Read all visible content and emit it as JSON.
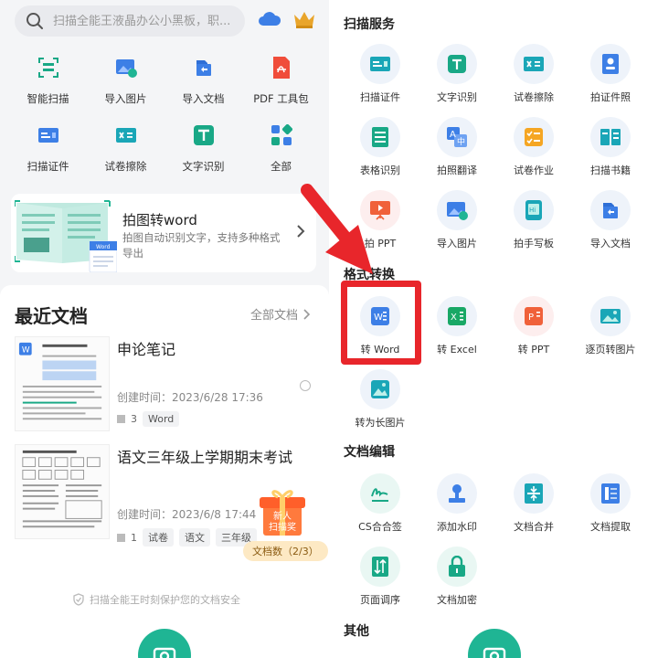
{
  "left": {
    "search": {
      "placeholder": "扫描全能王液晶办公小黑板，职..."
    },
    "top_icons": [
      "cloud-icon",
      "crown-icon"
    ],
    "tools": [
      {
        "label": "智能扫描",
        "icon": "scan-icon"
      },
      {
        "label": "导入图片",
        "icon": "import-image-icon"
      },
      {
        "label": "导入文档",
        "icon": "import-doc-icon"
      },
      {
        "label": "PDF 工具包",
        "icon": "pdf-icon"
      },
      {
        "label": "扫描证件",
        "icon": "id-card-icon"
      },
      {
        "label": "试卷擦除",
        "icon": "erase-icon"
      },
      {
        "label": "文字识别",
        "icon": "text-ocr-icon"
      },
      {
        "label": "全部",
        "icon": "all-apps-icon"
      }
    ],
    "promo": {
      "title": "拍图转word",
      "desc": "拍图自动识别文字，支持多种格式导出",
      "thumb_badge": "Word"
    },
    "recent": {
      "title": "最近文档",
      "all_label": "全部文档",
      "docs": [
        {
          "name": "申论笔记",
          "time": "创建时间：2023/6/28 17:36",
          "count": "3",
          "tags": [
            "Word"
          ]
        },
        {
          "name": "语文三年级上学期期末考试",
          "time": "创建时间：2023/6/8 17:44",
          "count": "1",
          "tags": [
            "试卷",
            "语文",
            "三年级"
          ]
        }
      ],
      "gift_line1": "新人",
      "gift_line2": "扫描奖",
      "doc_count": "文档数（2/3）",
      "security": "扫描全能王时刻保护您的文档安全"
    }
  },
  "right": {
    "sections": [
      {
        "title": "扫描服务",
        "items": [
          {
            "label": "扫描证件",
            "icon": "id-card-icon"
          },
          {
            "label": "文字识别",
            "icon": "text-ocr-icon"
          },
          {
            "label": "试卷擦除",
            "icon": "erase-icon"
          },
          {
            "label": "拍证件照",
            "icon": "id-photo-icon"
          },
          {
            "label": "表格识别",
            "icon": "table-icon"
          },
          {
            "label": "拍照翻译",
            "icon": "translate-icon"
          },
          {
            "label": "试卷作业",
            "icon": "homework-icon"
          },
          {
            "label": "扫描书籍",
            "icon": "book-icon"
          },
          {
            "label": "拍 PPT",
            "icon": "ppt-icon"
          },
          {
            "label": "导入图片",
            "icon": "import-image-icon"
          },
          {
            "label": "拍手写板",
            "icon": "handwriting-icon"
          },
          {
            "label": "导入文档",
            "icon": "import-doc-icon"
          }
        ]
      },
      {
        "title": "格式转换",
        "items": [
          {
            "label": "转 Word",
            "icon": "word-icon"
          },
          {
            "label": "转 Excel",
            "icon": "excel-icon"
          },
          {
            "label": "转 PPT",
            "icon": "ppt-convert-icon"
          },
          {
            "label": "逐页转图片",
            "icon": "image-pages-icon"
          },
          {
            "label": "转为长图片",
            "icon": "long-image-icon"
          }
        ]
      },
      {
        "title": "文档编辑",
        "items": [
          {
            "label": "CS合合签",
            "icon": "sign-icon"
          },
          {
            "label": "添加水印",
            "icon": "watermark-icon"
          },
          {
            "label": "文档合并",
            "icon": "merge-icon"
          },
          {
            "label": "文档提取",
            "icon": "extract-icon"
          },
          {
            "label": "页面调序",
            "icon": "reorder-icon"
          },
          {
            "label": "文档加密",
            "icon": "lock-icon"
          }
        ]
      },
      {
        "title": "其他",
        "items": []
      }
    ]
  },
  "colors": {
    "accent": "#1fb594",
    "highlight": "#e8262b",
    "blue": "#3d7fe6"
  }
}
